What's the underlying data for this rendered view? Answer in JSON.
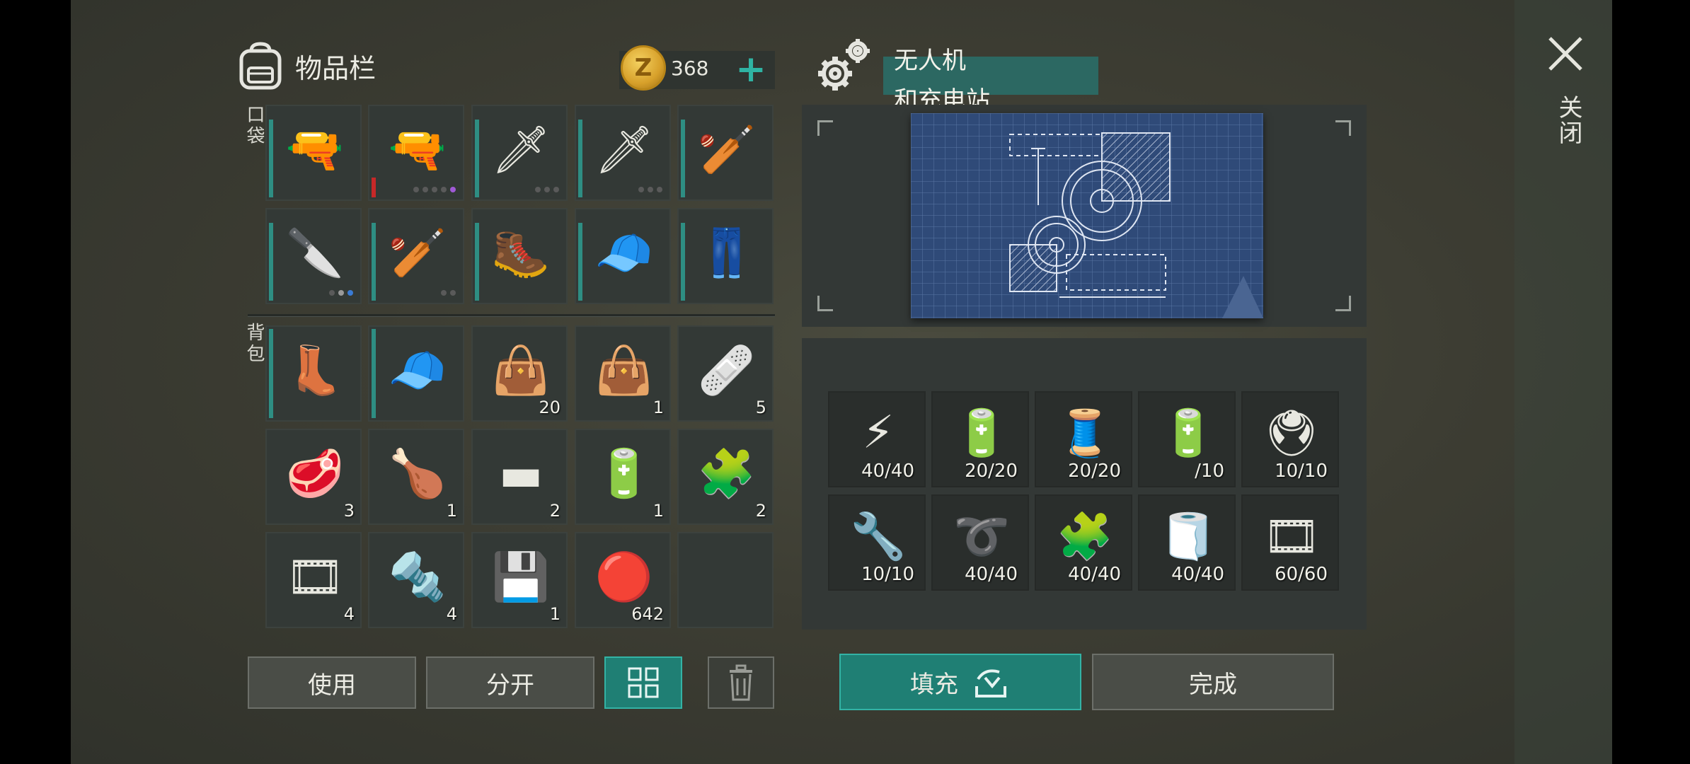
{
  "inventory": {
    "title": "物品栏",
    "coins": "368",
    "pocket_label": "口袋",
    "backpack_label": "背包",
    "pocket_slots": [
      {
        "name": "grenade-launcher-icon",
        "glyph": "🔫",
        "count": "",
        "dots": []
      },
      {
        "name": "shotgun-icon",
        "glyph": "🔫",
        "count": "",
        "dots": [
          "off",
          "off",
          "off",
          "off",
          "purple"
        ],
        "red": true
      },
      {
        "name": "machete-icon",
        "glyph": "🗡",
        "count": "",
        "dots": [
          "off",
          "off",
          "off"
        ]
      },
      {
        "name": "machete-icon",
        "glyph": "🗡",
        "count": "",
        "dots": [
          "off",
          "off",
          "off"
        ]
      },
      {
        "name": "paddle-icon",
        "glyph": "🏏",
        "count": "",
        "dots": []
      },
      {
        "name": "cleaver-icon",
        "glyph": "🔪",
        "count": "",
        "dots": [
          "off",
          "on",
          "blue"
        ]
      },
      {
        "name": "baseball-bat-icon",
        "glyph": "🏏",
        "count": "",
        "dots": [
          "off",
          "off"
        ]
      },
      {
        "name": "boots-icon",
        "glyph": "🥾",
        "count": "",
        "dots": []
      },
      {
        "name": "camo-cap-icon",
        "glyph": "🧢",
        "count": "",
        "dots": []
      },
      {
        "name": "camo-pants-icon",
        "glyph": "👖",
        "count": "",
        "dots": []
      }
    ],
    "backpack_slots": [
      {
        "name": "leather-boots-icon",
        "glyph": "👢",
        "count": ""
      },
      {
        "name": "beanie-icon",
        "glyph": "🧢",
        "count": ""
      },
      {
        "name": "first-aid-bag-icon",
        "glyph": "👜",
        "count": "20"
      },
      {
        "name": "first-aid-bag-icon",
        "glyph": "👜",
        "count": "1"
      },
      {
        "name": "bandage-icon",
        "glyph": "🩹",
        "count": "5"
      },
      {
        "name": "steak-icon",
        "glyph": "🥩",
        "count": "3"
      },
      {
        "name": "raw-chicken-icon",
        "glyph": "🍗",
        "count": "1"
      },
      {
        "name": "metal-ingot-icon",
        "glyph": "▬",
        "count": "2"
      },
      {
        "name": "car-battery-icon",
        "glyph": "🔋",
        "count": "1"
      },
      {
        "name": "electronic-parts-icon",
        "glyph": "🧩",
        "count": "2"
      },
      {
        "name": "blue-tape-icon",
        "glyph": "🎞",
        "count": "4"
      },
      {
        "name": "nuts-bolts-icon",
        "glyph": "🔩",
        "count": "4"
      },
      {
        "name": "usb-drive-icon",
        "glyph": "💾",
        "count": "1"
      },
      {
        "name": "bottle-cap-icon",
        "glyph": "🔴",
        "count": "642"
      },
      {
        "name": "empty-slot",
        "glyph": "",
        "count": ""
      }
    ],
    "buttons": {
      "use": "使用",
      "split": "分开",
      "delete_icon": "trash-icon",
      "sort_icon": "grid-icon"
    }
  },
  "recipe": {
    "title_line1": "无人机",
    "title_line2": "和充电站",
    "materials": [
      {
        "name": "transistor-icon",
        "glyph": "⚡",
        "count": "40/40"
      },
      {
        "name": "capacitors-icon",
        "glyph": "🔋",
        "count": "20/20"
      },
      {
        "name": "wire-spool-icon",
        "glyph": "🧵",
        "count": "20/20"
      },
      {
        "name": "car-battery-icon",
        "glyph": "🔋",
        "count": "/10"
      },
      {
        "name": "circuit-board-icon",
        "glyph": "🖲",
        "count": "10/10"
      },
      {
        "name": "hydraulic-piston-icon",
        "glyph": "🔧",
        "count": "10/10"
      },
      {
        "name": "cables-icon",
        "glyph": "➰",
        "count": "40/40"
      },
      {
        "name": "electronic-parts-icon",
        "glyph": "🧩",
        "count": "40/40"
      },
      {
        "name": "fiberglass-icon",
        "glyph": "🧻",
        "count": "40/40"
      },
      {
        "name": "blue-tape-icon",
        "glyph": "🎞",
        "count": "60/60"
      }
    ],
    "buttons": {
      "fill": "填充",
      "complete": "完成"
    }
  },
  "close_label": "关闭",
  "colors": {
    "accent": "#2fb3a3",
    "teal_button": "#1f7f74",
    "panel": "#333836"
  }
}
